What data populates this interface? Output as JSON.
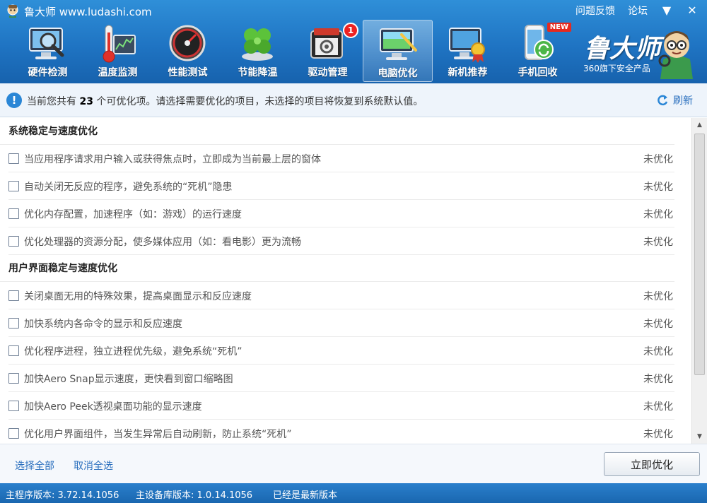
{
  "window": {
    "title": "鲁大师 www.ludashi.com",
    "links": [
      "问题反馈",
      "论坛"
    ],
    "menu_glyph": "▼",
    "close_glyph": "✕"
  },
  "nav": {
    "items": [
      {
        "label": "硬件检测",
        "icon": "monitor-magnifier-icon"
      },
      {
        "label": "温度监测",
        "icon": "thermometer-icon"
      },
      {
        "label": "性能测试",
        "icon": "speedometer-icon"
      },
      {
        "label": "节能降温",
        "icon": "clover-icon"
      },
      {
        "label": "驱动管理",
        "icon": "driver-board-icon",
        "badge": "1"
      },
      {
        "label": "电脑优化",
        "icon": "monitor-brush-icon",
        "active": true
      },
      {
        "label": "新机推荐",
        "icon": "monitor-medal-icon"
      },
      {
        "label": "手机回收",
        "icon": "phone-recycle-icon",
        "tag": "NEW"
      }
    ]
  },
  "brand": {
    "name": "鲁大师",
    "subtitle": "360旗下安全产品"
  },
  "info": {
    "prefix": "当前您共有",
    "count": "23",
    "suffix": "个可优化项。请选择需要优化的项目，未选择的项目将恢复到系统默认值。",
    "refresh_label": "刷新"
  },
  "sections": [
    {
      "title": "系统稳定与速度优化",
      "items": [
        {
          "label": "当应用程序请求用户输入或获得焦点时，立即成为当前最上层的窗体",
          "status": "未优化"
        },
        {
          "label": "自动关闭无反应的程序，避免系统的“死机”隐患",
          "status": "未优化"
        },
        {
          "label": "优化内存配置，加速程序（如：游戏）的运行速度",
          "status": "未优化"
        },
        {
          "label": "优化处理器的资源分配，使多媒体应用（如：看电影）更为流畅",
          "status": "未优化"
        }
      ]
    },
    {
      "title": "用户界面稳定与速度优化",
      "items": [
        {
          "label": "关闭桌面无用的特殊效果，提高桌面显示和反应速度",
          "status": "未优化"
        },
        {
          "label": "加快系统内各命令的显示和反应速度",
          "status": "未优化"
        },
        {
          "label": "优化程序进程，独立进程优先级，避免系统“死机”",
          "status": "未优化"
        },
        {
          "label": "加快Aero Snap显示速度，更快看到窗口缩略图",
          "status": "未优化"
        },
        {
          "label": "加快Aero Peek透视桌面功能的显示速度",
          "status": "未优化"
        },
        {
          "label": "优化用户界面组件，当发生异常后自动刷新，防止系统“死机”",
          "status": "未优化"
        }
      ]
    }
  ],
  "footer": {
    "select_all": "选择全部",
    "deselect_all": "取消全选",
    "optimize_button": "立即优化"
  },
  "status": {
    "main_version": "主程序版本: 3.72.14.1056",
    "db_version": "主设备库版本: 1.0.14.1056",
    "update_state": "已经是最新版本"
  }
}
